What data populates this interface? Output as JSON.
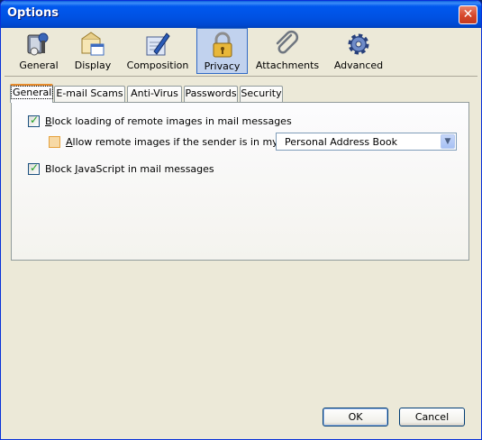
{
  "window": {
    "title": "Options",
    "close_icon": "close-icon"
  },
  "toolbar": {
    "items": [
      {
        "label": "General",
        "icon": "general-icon"
      },
      {
        "label": "Display",
        "icon": "display-icon"
      },
      {
        "label": "Composition",
        "icon": "composition-icon"
      },
      {
        "label": "Privacy",
        "icon": "lock-icon",
        "selected": true
      },
      {
        "label": "Attachments",
        "icon": "paperclip-icon"
      },
      {
        "label": "Advanced",
        "icon": "gear-icon"
      }
    ]
  },
  "tabs": [
    {
      "label": "General",
      "active": true
    },
    {
      "label": "E-mail Scams"
    },
    {
      "label": "Anti-Virus"
    },
    {
      "label": "Passwords"
    },
    {
      "label": "Security"
    }
  ],
  "general": {
    "block_remote_images": {
      "label_prefix": "",
      "label_access": "B",
      "label_rest": "lock loading of remote images in mail messages",
      "checked": true
    },
    "allow_remote_images": {
      "label_access": "A",
      "label_rest": "llow remote images if the sender is in my:",
      "checked": false
    },
    "address_book_select": {
      "value": "Personal Address Book"
    },
    "block_javascript": {
      "label_prefix": "Block ",
      "label_access": "J",
      "label_rest": "avaScript in mail messages",
      "checked": true
    }
  },
  "buttons": {
    "ok": "OK",
    "cancel": "Cancel"
  },
  "colors": {
    "titlebar": "#0058ee",
    "selected_tool_bg": "#c1d2ee",
    "active_tab_accent": "#e68b2c",
    "check_green": "#21a121"
  }
}
